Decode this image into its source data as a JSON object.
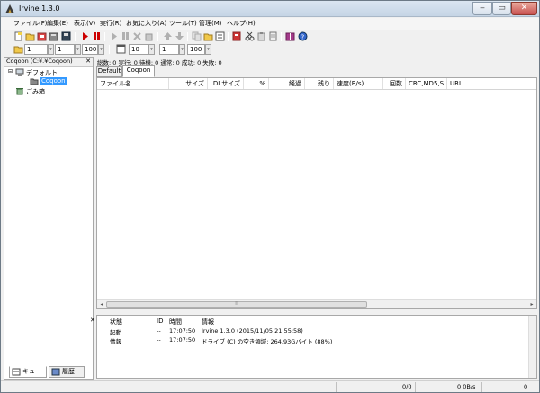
{
  "window": {
    "title": "Irvine 1.3.0"
  },
  "menu": [
    "ファイル(F)",
    "編集(E)",
    "表示(V)",
    "実行(R)",
    "お気に入り(A)",
    "ツール(T)",
    "管理(M)",
    "ヘルプ(H)"
  ],
  "toolbar2": {
    "spin1": "1",
    "spin2": "1",
    "spin3": "100",
    "spin4": "10",
    "spin5": "1",
    "spin6": "100"
  },
  "left_pane": {
    "header": "Coqoon (C:¥.¥Coqoon)",
    "close": "✕",
    "tree": {
      "default_folder": "デフォルト",
      "coqoon": "Coqoon",
      "trash": "ごみ箱"
    },
    "tabs": {
      "queue": "キュー",
      "history": "履歴"
    }
  },
  "stats": "総数: 0  実行: 0  待機: 0  通常: 0  成功: 0  失敗: 0",
  "tabs": [
    "Default",
    "Coqoon"
  ],
  "columns": [
    "ファイル名",
    "サイズ",
    "DLサイズ",
    "%",
    "経過",
    "残り",
    "速度(B/s)",
    "回数",
    "CRC,MD5,S...",
    "URL"
  ],
  "log": {
    "close": "✕",
    "columns": [
      "状態",
      "ID",
      "時間",
      "情報"
    ],
    "rows": [
      {
        "status": "起動",
        "id": "--",
        "time": "17:07:50",
        "info": "Irvine 1.3.0 (2015/11/05 21:55:58)"
      },
      {
        "status": "情報",
        "id": "--",
        "time": "17:07:50",
        "info": "ドライブ (C) の空き領域: 264.93Gバイト (88%)"
      }
    ]
  },
  "statusbar": {
    "count": "0/0",
    "speed": "0 0B/s",
    "last": "0"
  },
  "colors": {
    "accent": "#3399ff",
    "stop_red": "#cc0000"
  }
}
